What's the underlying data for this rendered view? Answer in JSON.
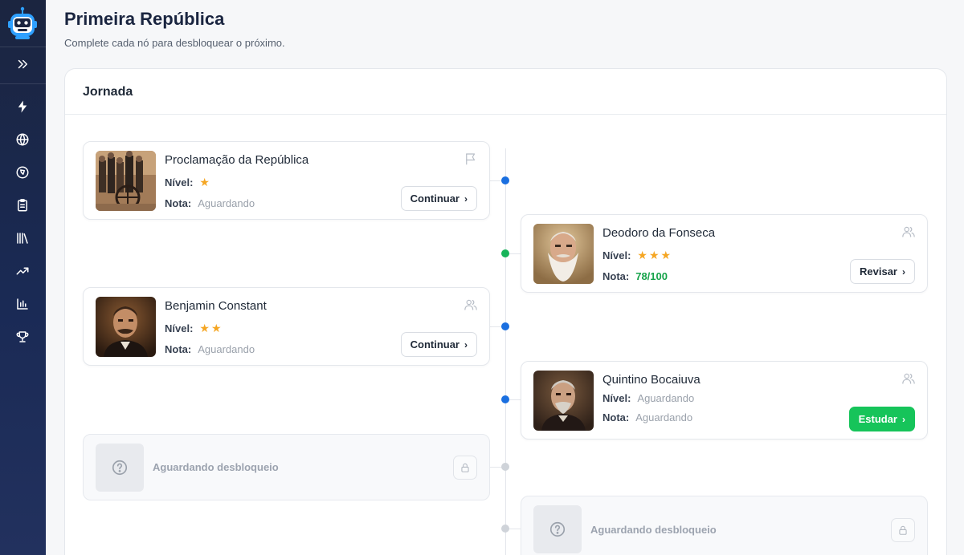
{
  "header": {
    "title": "Primeira República",
    "subtitle": "Complete cada nó para desbloquear o próximo."
  },
  "sidebar": {
    "items": [
      {
        "icon": "expand-icon"
      },
      {
        "icon": "lightning-icon"
      },
      {
        "icon": "globe-icon"
      },
      {
        "icon": "compass-icon"
      },
      {
        "icon": "clipboard-icon"
      },
      {
        "icon": "library-icon"
      },
      {
        "icon": "trending-icon"
      },
      {
        "icon": "bar-chart-icon"
      },
      {
        "icon": "trophy-icon"
      }
    ]
  },
  "panel": {
    "title": "Jornada"
  },
  "labels": {
    "level": "Nível:",
    "grade": "Nota:"
  },
  "nodes": [
    {
      "name": "Proclamação da República",
      "stars": "★",
      "level_value": "",
      "grade": "Aguardando",
      "button": "Continuar",
      "status_color": "#1a6fe0",
      "corner_icon": "flag-icon"
    },
    {
      "name": "Deodoro da Fonseca",
      "stars": "★★★",
      "level_value": "",
      "grade": "78/100",
      "button": "Revisar",
      "status_color": "#17b45a",
      "corner_icon": "users-icon"
    },
    {
      "name": "Benjamin Constant",
      "stars": "★★",
      "level_value": "",
      "grade": "Aguardando",
      "button": "Continuar",
      "status_color": "#1a6fe0",
      "corner_icon": "users-icon"
    },
    {
      "name": "Quintino Bocaiuva",
      "stars": "",
      "level_value": "Aguardando",
      "grade": "Aguardando",
      "button": "Estudar",
      "status_color": "#1a6fe0",
      "corner_icon": "users-icon"
    }
  ],
  "locked": [
    {
      "text": "Aguardando desbloqueio"
    },
    {
      "text": "Aguardando desbloqueio"
    }
  ],
  "colors": {
    "sidebar": "#1b2540",
    "accent_blue": "#1a6fe0",
    "accent_green": "#16c45a",
    "star": "#f5a623",
    "locked_dot": "#cfd3d9"
  }
}
